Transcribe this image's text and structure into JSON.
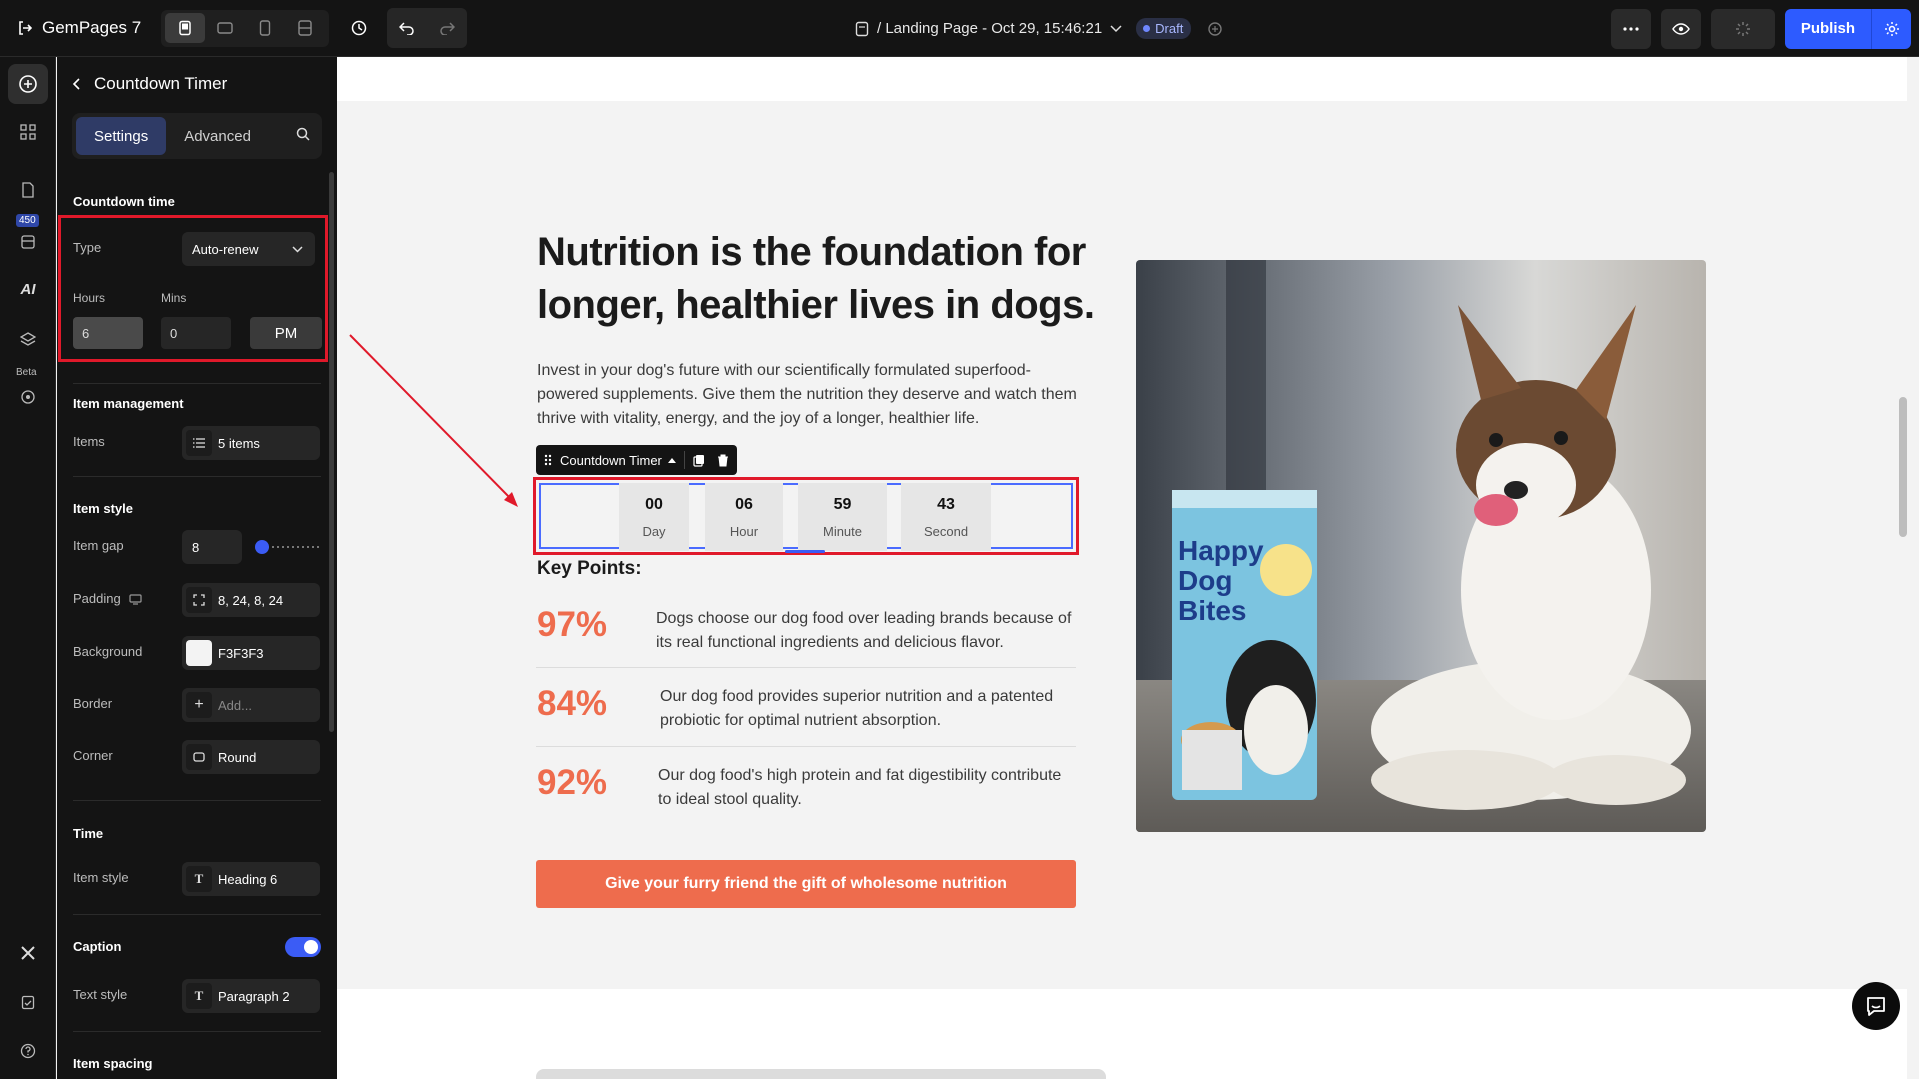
{
  "topbar": {
    "brand": "GemPages 7",
    "page_name": "/ Landing Page - Oct 29, 15:46:21",
    "status": "Draft",
    "publish_label": "Publish"
  },
  "rail": {
    "badge": "450",
    "ai_label": "AI",
    "beta_label": "Beta"
  },
  "panel": {
    "title": "Countdown Timer",
    "tabs": [
      "Settings",
      "Advanced"
    ],
    "countdown_time": {
      "title": "Countdown time",
      "type_label": "Type",
      "type_value": "Auto-renew",
      "hours_label": "Hours",
      "mins_label": "Mins",
      "hours_value": "6",
      "mins_value": "0",
      "ampm": "PM"
    },
    "item_management": {
      "title": "Item management",
      "items_label": "Items",
      "items_value": "5 items"
    },
    "item_style": {
      "title": "Item style",
      "gap_label": "Item gap",
      "gap_value": "8",
      "padding_label": "Padding",
      "padding_value": "8, 24, 8, 24",
      "background_label": "Background",
      "background_value": "F3F3F3",
      "border_label": "Border",
      "border_value": "Add...",
      "corner_label": "Corner",
      "corner_value": "Round"
    },
    "time": {
      "title": "Time",
      "item_style_label": "Item style",
      "item_style_value": "Heading 6"
    },
    "caption": {
      "title": "Caption",
      "text_style_label": "Text style",
      "text_style_value": "Paragraph 2",
      "enabled": true
    },
    "item_spacing": {
      "title": "Item spacing"
    }
  },
  "canvas": {
    "headline": "Nutrition is the foundation for longer, healthier lives in dogs.",
    "intro": "Invest in your dog's future with our scientifically formulated superfood-powered supplements. Give them the nutrition they deserve and watch them thrive with vitality, energy, and the joy of a longer, healthier life.",
    "timer_toolbar_label": "Countdown Timer",
    "timer": [
      {
        "value": "00",
        "caption": "Day"
      },
      {
        "value": "06",
        "caption": "Hour"
      },
      {
        "value": "59",
        "caption": "Minute"
      },
      {
        "value": "43",
        "caption": "Second"
      }
    ],
    "key_points_title": "Key Points:",
    "key_points": [
      {
        "pct": "97%",
        "text": "Dogs choose our dog food over leading brands because of its real functional ingredients and delicious flavor."
      },
      {
        "pct": "84%",
        "text": "Our dog food provides superior nutrition and a patented probiotic for optimal nutrient absorption."
      },
      {
        "pct": "92%",
        "text": "Our dog food's high protein and fat digestibility contribute to ideal stool quality."
      }
    ],
    "cta": "Give your furry friend the gift of wholesome nutrition",
    "product_bag": {
      "line1": "Happy",
      "line2": "Dog",
      "line3": "Bites"
    }
  },
  "colors": {
    "accent": "#ee6c4d",
    "primary": "#2d5bff",
    "highlight": "#e0192a"
  }
}
